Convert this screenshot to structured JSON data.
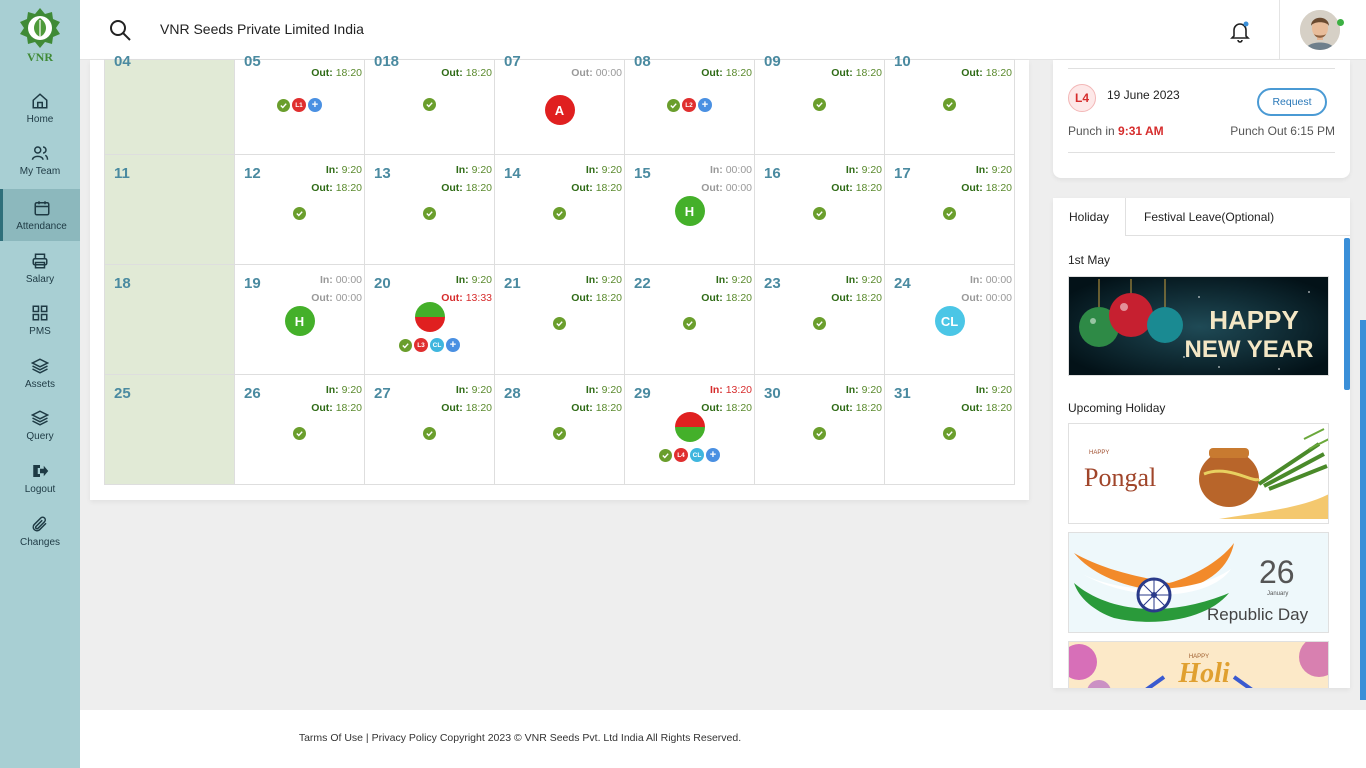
{
  "app": {
    "company": "VNR Seeds Private Limited India",
    "logo_text": "VNR"
  },
  "sidebar": {
    "items": [
      {
        "label": "Home",
        "icon": "home-icon"
      },
      {
        "label": "My Team",
        "icon": "team-icon"
      },
      {
        "label": "Attendance",
        "icon": "calendar-icon",
        "active": true
      },
      {
        "label": "Salary",
        "icon": "printer-icon"
      },
      {
        "label": "PMS",
        "icon": "grid-icon"
      },
      {
        "label": "Assets",
        "icon": "layers-icon"
      },
      {
        "label": "Query",
        "icon": "layers-icon"
      },
      {
        "label": "Logout",
        "icon": "logout-icon"
      },
      {
        "label": "Changes",
        "icon": "paperclip-icon"
      }
    ]
  },
  "calendar": {
    "rows": [
      [
        {
          "day": "04",
          "sunday": true
        },
        {
          "day": "05",
          "out": "18:20",
          "badges": [
            "check",
            "L1",
            "plus"
          ]
        },
        {
          "day": "018",
          "out": "18:20",
          "badges": [
            "check"
          ]
        },
        {
          "day": "07",
          "out": "00:00",
          "out_style": "grey",
          "circle": "A"
        },
        {
          "day": "08",
          "out": "18:20",
          "badges": [
            "check",
            "L2",
            "plus"
          ]
        },
        {
          "day": "09",
          "out": "18:20",
          "badges": [
            "check"
          ]
        },
        {
          "day": "10",
          "out": "18:20",
          "badges": [
            "check"
          ]
        }
      ],
      [
        {
          "day": "11",
          "sunday": true
        },
        {
          "day": "12",
          "in": "9:20",
          "out": "18:20",
          "badges": [
            "check"
          ]
        },
        {
          "day": "13",
          "in": "9:20",
          "out": "18:20",
          "badges": [
            "check"
          ]
        },
        {
          "day": "14",
          "in": "9:20",
          "out": "18:20",
          "badges": [
            "check"
          ]
        },
        {
          "day": "15",
          "in": "00:00",
          "out": "00:00",
          "in_style": "grey",
          "out_style": "grey",
          "circle": "H"
        },
        {
          "day": "16",
          "in": "9:20",
          "out": "18:20",
          "badges": [
            "check"
          ]
        },
        {
          "day": "17",
          "in": "9:20",
          "out": "18:20",
          "badges": [
            "check"
          ]
        }
      ],
      [
        {
          "day": "18",
          "sunday": true
        },
        {
          "day": "19",
          "in": "00:00",
          "out": "00:00",
          "in_style": "grey",
          "out_style": "grey",
          "circle": "H"
        },
        {
          "day": "20",
          "in": "9:20",
          "out": "13:33",
          "out_style": "red",
          "half": "top-green",
          "badges": [
            "check",
            "L3",
            "CL",
            "plus"
          ]
        },
        {
          "day": "21",
          "in": "9:20",
          "out": "18:20",
          "badges": [
            "check"
          ]
        },
        {
          "day": "22",
          "in": "9:20",
          "out": "18:20",
          "badges": [
            "check"
          ]
        },
        {
          "day": "23",
          "in": "9:20",
          "out": "18:20",
          "badges": [
            "check"
          ]
        },
        {
          "day": "24",
          "in": "00:00",
          "out": "00:00",
          "in_style": "grey",
          "out_style": "grey",
          "circle": "CL"
        }
      ],
      [
        {
          "day": "25",
          "sunday": true
        },
        {
          "day": "26",
          "in": "9:20",
          "out": "18:20",
          "badges": [
            "check"
          ]
        },
        {
          "day": "27",
          "in": "9:20",
          "out": "18:20",
          "badges": [
            "check"
          ]
        },
        {
          "day": "28",
          "in": "9:20",
          "out": "18:20",
          "badges": [
            "check"
          ]
        },
        {
          "day": "29",
          "in": "13:20",
          "in_style": "red",
          "out": "18:20",
          "half": "top-red",
          "badges": [
            "check",
            "L4",
            "CL",
            "plus"
          ]
        },
        {
          "day": "30",
          "in": "9:20",
          "out": "18:20",
          "badges": [
            "check"
          ]
        },
        {
          "day": "31",
          "in": "9:20",
          "out": "18:20",
          "badges": [
            "check"
          ]
        }
      ]
    ],
    "in_label": "In:",
    "out_label": "Out:"
  },
  "punch": {
    "leave_code": "L4",
    "date": "19 June 2023",
    "request_label": "Request",
    "punch_in_label": "Punch in",
    "punch_in_time": "9:31 AM",
    "punch_out_text": "Punch Out 6:15 PM"
  },
  "holidays": {
    "tabs": [
      "Holiday",
      "Festival Leave(Optional)"
    ],
    "current_date": "1st May",
    "current_image": {
      "line1": "HAPPY",
      "line2": "NEW YEAR"
    },
    "upcoming_label": "Upcoming Holiday",
    "upcoming_images": [
      {
        "small": "HAPPY",
        "big": "Pongal"
      },
      {
        "num": "26",
        "small": "January",
        "big": "Republic Day"
      },
      {
        "small": "HAPPY",
        "big": "Holi"
      }
    ]
  },
  "footer": {
    "text": "Tarms Of Use | Privacy Policy Copyright 2023 © VNR Seeds Pvt. Ltd India All Rights Reserved."
  },
  "colors": {
    "sidebar": "#a8cfd3",
    "sunday": "#e1ead6",
    "day_number": "#4a8aa0",
    "present": "#6a9e2c",
    "absent": "#e02020",
    "accent": "#3a8fd8"
  }
}
